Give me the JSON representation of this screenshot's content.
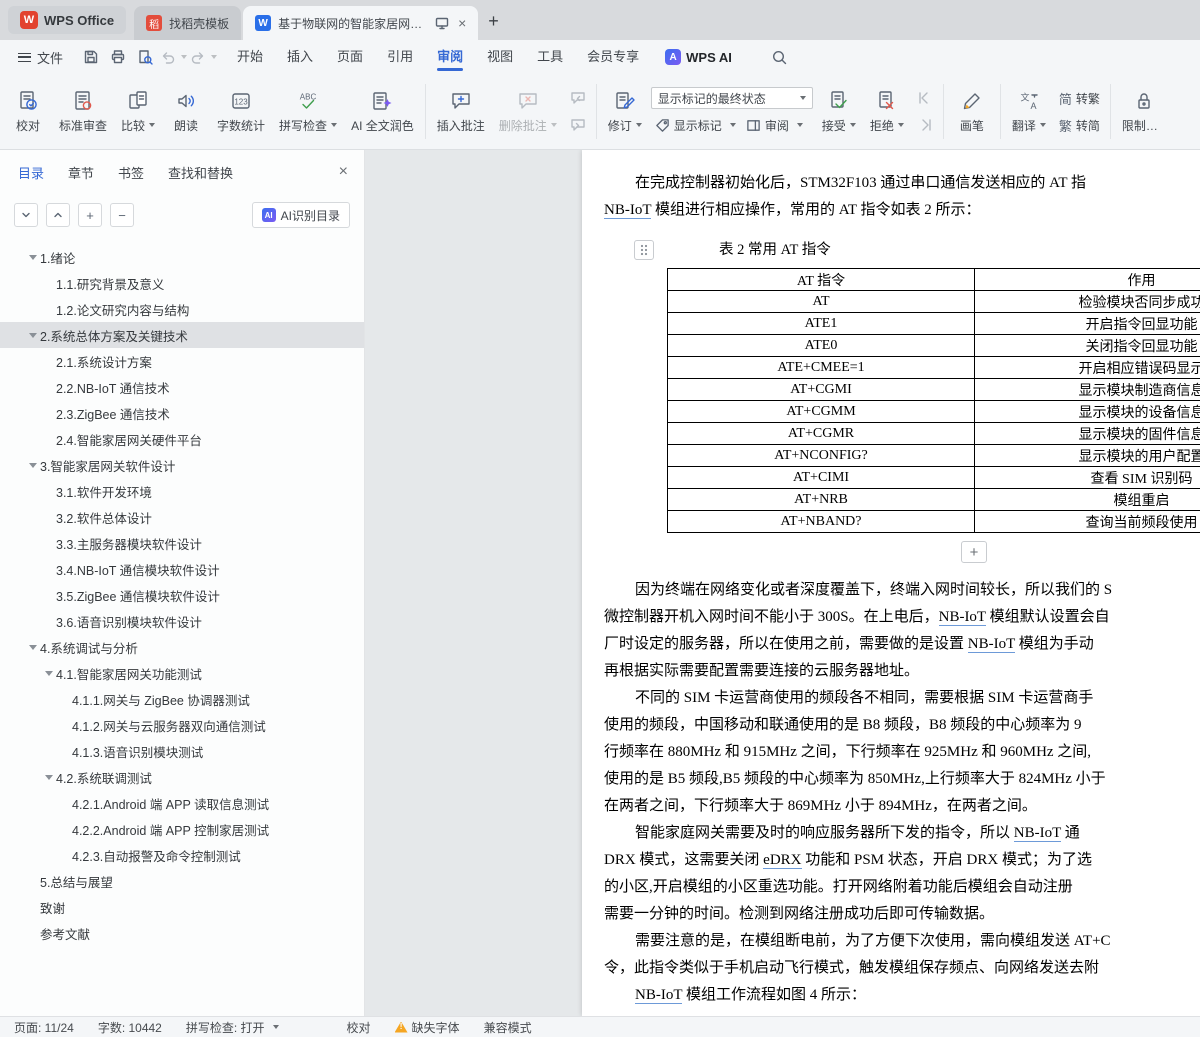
{
  "titlebar": {
    "wps_button": "WPS Office",
    "template_tab": "找稻壳模板",
    "doc_title": "基于物联网的智能家居网关设..."
  },
  "menubar": {
    "file": "文件",
    "menus": [
      {
        "label": "开始"
      },
      {
        "label": "插入"
      },
      {
        "label": "页面"
      },
      {
        "label": "引用"
      },
      {
        "label": "审阅",
        "active": true
      },
      {
        "label": "视图"
      },
      {
        "label": "工具"
      },
      {
        "label": "会员专享"
      }
    ],
    "wps_ai": "WPS AI"
  },
  "ribbon": {
    "proofread": "校对",
    "standard_review": "标准审查",
    "compare": "比较",
    "read_aloud": "朗读",
    "word_count": "字数统计",
    "spell_check": "拼写检查",
    "ai_polish": "AI 全文润色",
    "insert_comment": "插入批注",
    "delete_comment": "删除批注",
    "revise": "修订",
    "markup_state": "显示标记的最终状态",
    "show_markup": "显示标记",
    "review_pane": "审阅",
    "accept": "接受",
    "reject": "拒绝",
    "brush": "画笔",
    "translate": "翻译",
    "simp_icon": "简",
    "trad_icon": "繁",
    "to_trad": "转繁",
    "to_simp": "转简",
    "restrict_edit": "限制编辑"
  },
  "sidebar": {
    "tabs": [
      {
        "label": "目录",
        "active": true
      },
      {
        "label": "章节"
      },
      {
        "label": "书签"
      },
      {
        "label": "查找和替换"
      }
    ],
    "ai_button": "AI识别目录",
    "outline": [
      {
        "label": "1.绪论",
        "cls": "lvl1 caret"
      },
      {
        "label": "1.1.研究背景及意义",
        "cls": "lvl2"
      },
      {
        "label": "1.2.论文研究内容与结构",
        "cls": "lvl2"
      },
      {
        "label": "2.系统总体方案及关键技术",
        "cls": "lvl1 caret selected"
      },
      {
        "label": "2.1.系统设计方案",
        "cls": "lvl2"
      },
      {
        "label": "2.2.NB-IoT 通信技术",
        "cls": "lvl2"
      },
      {
        "label": "2.3.ZigBee 通信技术",
        "cls": "lvl2"
      },
      {
        "label": "2.4.智能家居网关硬件平台",
        "cls": "lvl2"
      },
      {
        "label": "3.智能家居网关软件设计",
        "cls": "lvl1 caret"
      },
      {
        "label": "3.1.软件开发环境",
        "cls": "lvl2"
      },
      {
        "label": "3.2.软件总体设计",
        "cls": "lvl2"
      },
      {
        "label": "3.3.主服务器模块软件设计",
        "cls": "lvl2"
      },
      {
        "label": "3.4.NB-IoT 通信模块软件设计",
        "cls": "lvl2"
      },
      {
        "label": "3.5.ZigBee 通信模块软件设计",
        "cls": "lvl2"
      },
      {
        "label": "3.6.语音识别模块软件设计",
        "cls": "lvl2"
      },
      {
        "label": "4.系统调试与分析",
        "cls": "lvl1 caret"
      },
      {
        "label": "4.1.智能家居网关功能测试",
        "cls": "lvl2 caret"
      },
      {
        "label": "4.1.1.网关与 ZigBee 协调器测试",
        "cls": "lvl3"
      },
      {
        "label": "4.1.2.网关与云服务器双向通信测试",
        "cls": "lvl3"
      },
      {
        "label": "4.1.3.语音识别模块测试",
        "cls": "lvl3"
      },
      {
        "label": "4.2.系统联调测试",
        "cls": "lvl2 caret"
      },
      {
        "label": "4.2.1.Android 端 APP 读取信息测试",
        "cls": "lvl3"
      },
      {
        "label": "4.2.2.Android 端 APP 控制家居测试",
        "cls": "lvl3"
      },
      {
        "label": "4.2.3.自动报警及命令控制测试",
        "cls": "lvl3"
      },
      {
        "label": "5.总结与展望",
        "cls": "lvl1"
      },
      {
        "label": "致谢",
        "cls": "lvl1"
      },
      {
        "label": "参考文献",
        "cls": "lvl1"
      }
    ]
  },
  "document": {
    "para1_lines": [
      {
        "text": "在完成控制器初始化后，STM32F103 通过串口通信发送相应的 AT 指",
        "indent": true
      },
      {
        "text": "NB-IoT 模组进行相应操作，常用的 AT 指令如表 2 所示："
      }
    ],
    "table_caption": "表 2 常用 AT 指令",
    "table": {
      "headers": [
        "AT 指令",
        "作用"
      ],
      "rows": [
        [
          "AT",
          "检验模块否同步成功"
        ],
        [
          "ATE1",
          "开启指令回显功能"
        ],
        [
          "ATE0",
          "关闭指令回显功能"
        ],
        [
          "ATE+CMEE=1",
          "开启相应错误码显示"
        ],
        [
          "AT+CGMI",
          "显示模块制造商信息"
        ],
        [
          "AT+CGMM",
          "显示模块的设备信息"
        ],
        [
          "AT+CGMR",
          "显示模块的固件信息"
        ],
        [
          "AT+NCONFIG?",
          "显示模块的用户配置"
        ],
        [
          "AT+CIMI",
          "查看 SIM 识别码"
        ],
        [
          "AT+NRB",
          "模组重启"
        ],
        [
          "AT+NBAND?",
          "查询当前频段使用"
        ]
      ]
    },
    "body_lines": [
      {
        "text": "因为终端在网络变化或者深度覆盖下，终端入网时间较长，所以我们的 S",
        "indent": true
      },
      {
        "text": "微控制器开机入网时间不能小于 300S。在上电后，NB-IoT 模组默认设置会自"
      },
      {
        "text": "厂时设定的服务器，所以在使用之前，需要做的是设置 NB-IoT 模组为手动"
      },
      {
        "text": "再根据实际需要配置需要连接的云服务器地址。"
      },
      {
        "text": "不同的 SIM 卡运营商使用的频段各不相同，需要根据 SIM 卡运营商手",
        "indent": true
      },
      {
        "text": "使用的频段，中国移动和联通使用的是 B8 频段，B8 频段的中心频率为 9"
      },
      {
        "text": "行频率在 880MHz 和 915MHz 之间，下行频率在 925MHz 和 960MHz 之间,"
      },
      {
        "text": "使用的是 B5 频段,B5 频段的中心频率为 850MHz,上行频率大于 824MHz 小于"
      },
      {
        "text": "在两者之间，下行频率大于 869MHz 小于 894MHz，在两者之间。"
      },
      {
        "text": "智能家庭网关需要及时的响应服务器所下发的指令，所以 NB-IoT 通",
        "indent": true
      },
      {
        "text": "DRX 模式，这需要关闭 eDRX 功能和 PSM 状态，开启 DRX 模式；为了选"
      },
      {
        "text": "的小区,开启模组的小区重选功能。打开网络附着功能后模组会自动注册"
      },
      {
        "text": "需要一分钟的时间。检测到网络注册成功后即可传输数据。"
      },
      {
        "text": "需要注意的是，在模组断电前，为了方便下次使用，需向模组发送 AT+C",
        "indent": true
      },
      {
        "text": "令，此指令类似于手机启动飞行模式，触发模组保存频点、向网络发送去附"
      },
      {
        "text": "NB-IoT 模组工作流程如图 4 所示：",
        "indent": true
      }
    ],
    "underline_tokens": [
      "NB-IoT",
      "eDRX"
    ]
  },
  "statusbar": {
    "page": "页面: 11/24",
    "words": "字数: 10442",
    "spell": "拼写检查: 打开",
    "proofread": "校对",
    "missing_font": "缺失字体",
    "compat": "兼容模式"
  }
}
